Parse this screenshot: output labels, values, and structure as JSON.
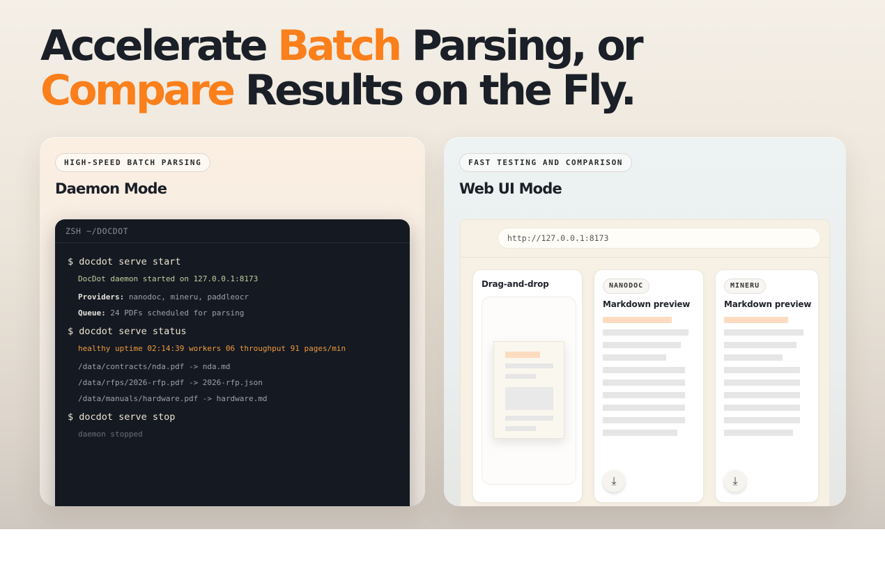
{
  "headline": {
    "line1_a": "Accelerate ",
    "line1_accent": "Batch",
    "line1_b": " Parsing, or",
    "line2_accent": "Compare",
    "line2_b": " Results on the Fly."
  },
  "daemon": {
    "badge": "HIGH-SPEED BATCH PARSING",
    "title": "Daemon Mode",
    "terminal": {
      "header": "ZSH ~/DOCDOT",
      "cmd1": "$ docdot serve start",
      "started": "DocDot daemon started on 127.0.0.1:8173",
      "providers_label": "Providers:",
      "providers_value": " nanodoc, mineru, paddleocr",
      "queue_label": "Queue:",
      "queue_value": " 24 PDFs scheduled for parsing",
      "cmd2": "$ docdot serve status",
      "status": "healthy uptime 02:14:39 workers 06 throughput 91 pages/min",
      "file1": "/data/contracts/nda.pdf -> nda.md",
      "file2": "/data/rfps/2026-rfp.pdf -> 2026-rfp.json",
      "file3": "/data/manuals/hardware.pdf -> hardware.md",
      "cmd3": "$ docdot serve stop",
      "stopped": "daemon stopped"
    }
  },
  "webui": {
    "badge": "FAST TESTING AND COMPARISON",
    "title": "Web UI Mode",
    "url": "http://127.0.0.1:8173",
    "dropzone_title": "Drag-and-drop",
    "panels": [
      {
        "tag": "NANODOC",
        "title": "Markdown preview"
      },
      {
        "tag": "MINERU",
        "title": "Markdown preview"
      }
    ],
    "download_icon": "download-icon"
  },
  "colors": {
    "accent": "#fb7f1b",
    "ink": "#1b1f27",
    "terminal_bg": "#141922",
    "status_orange": "#f19a3a",
    "started_green": "#c5cf9e"
  }
}
